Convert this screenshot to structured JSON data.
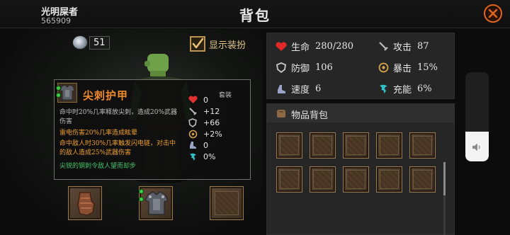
{
  "header": {
    "player_name": "光明屎者",
    "player_id": "565909",
    "title": "背包"
  },
  "currency": {
    "icon": "silver-coin-icon",
    "count": "51"
  },
  "show_equipment": {
    "label": "显示装扮",
    "checked": true
  },
  "tooltip": {
    "item_name": "尖刺护甲",
    "set_label": "套装",
    "descriptions": [
      {
        "text": "命中时20%几率释放尖刺，造成20%武器伤害",
        "color": "grey"
      },
      {
        "text": "雷电伤害20%几率造成眩晕",
        "color": "orange"
      },
      {
        "text": "命中敌人时30%几率触发闪电链，对击中的敌人造成25%武器伤害",
        "color": "orange"
      },
      {
        "text": "尖锐的钢刺令敌人望而却步",
        "color": "green"
      }
    ],
    "stats": [
      {
        "icon": "heart-icon",
        "value": "0"
      },
      {
        "icon": "sword-icon",
        "value": "+12"
      },
      {
        "icon": "shield-icon",
        "value": "+66"
      },
      {
        "icon": "crit-icon",
        "value": "+2%"
      },
      {
        "icon": "boot-icon",
        "value": "0"
      },
      {
        "icon": "energy-icon",
        "value": "0%"
      }
    ]
  },
  "equipment_slots": [
    {
      "name": "gauntlet-slot",
      "content": "gauntlet-icon"
    },
    {
      "name": "armor-slot",
      "content": "armor-icon"
    },
    {
      "name": "empty-slot",
      "content": ""
    }
  ],
  "stats": {
    "hp_label": "生命",
    "hp_value": "280/280",
    "attack_label": "攻击",
    "attack_value": "87",
    "defense_label": "防御",
    "defense_value": "106",
    "crit_label": "暴击",
    "crit_value": "15%",
    "speed_label": "速度",
    "speed_value": "6",
    "charge_label": "充能",
    "charge_value": "6%"
  },
  "inventory": {
    "title": "物品背包",
    "slot_count": 10,
    "scroll_fraction": 0.45
  },
  "volume": {
    "icon": "speaker-icon",
    "level": 0.33
  },
  "colors": {
    "item_name": "#f08a2c",
    "accent_orange": "#e2631f",
    "stat_green": "#45c46a",
    "frame_gold": "#9a7b4e"
  }
}
